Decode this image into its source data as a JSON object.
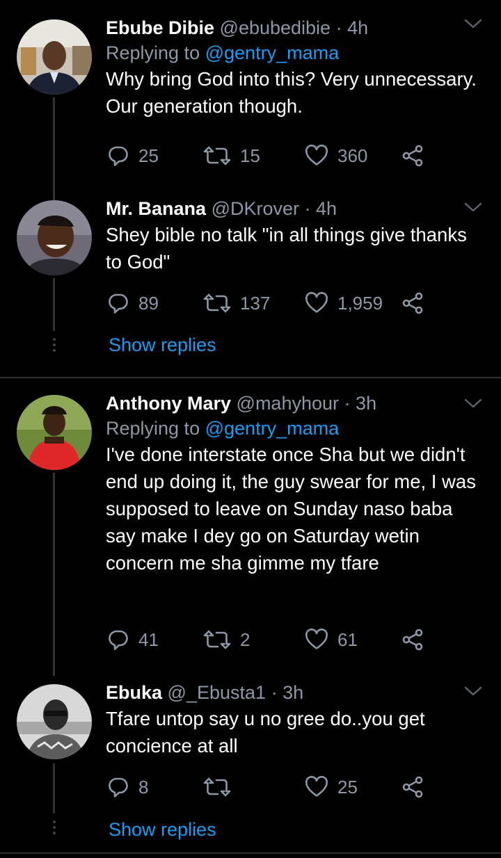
{
  "tweets": [
    {
      "name": "Ebube Dibie",
      "handle": "@ebubedibie",
      "sep": "·",
      "time": "4h",
      "replying_prefix": "Replying to",
      "replying_to": "@gentry_mama",
      "text": "Why bring God into this? Very unnecessary. Our generation though.",
      "replies": "25",
      "retweets": "15",
      "likes": "360"
    },
    {
      "name": "Mr. Banana",
      "handle": "@DKrover",
      "sep": "·",
      "time": "4h",
      "text": "Shey bible no talk \"in all things give thanks to God\"",
      "replies": "89",
      "retweets": "137",
      "likes": "1,959"
    },
    {
      "name": "Anthony Mary",
      "handle": "@mahyhour",
      "sep": "·",
      "time": "3h",
      "replying_prefix": "Replying to",
      "replying_to": "@gentry_mama",
      "text": "I've done interstate once Sha but we didn't end up doing it, the guy swear for me, I was supposed to leave on Sunday naso baba say make I dey go on Saturday wetin concern me sha gimme my tfare",
      "replies": "41",
      "retweets": "2",
      "likes": "61"
    },
    {
      "name": "Ebuka",
      "handle": "@_Ebusta1",
      "sep": "·",
      "time": "3h",
      "text": "Tfare untop say u no gree do..you get concience at all",
      "replies": "8",
      "retweets": "",
      "likes": "25"
    }
  ],
  "show_replies_label": "Show replies",
  "colors": {
    "background": "#000000",
    "accent": "#1d9bf0",
    "muted": "#8b98a5",
    "line": "#2f3336"
  },
  "icons": [
    "chevron-down-icon",
    "reply-icon",
    "retweet-icon",
    "like-icon",
    "share-icon"
  ]
}
